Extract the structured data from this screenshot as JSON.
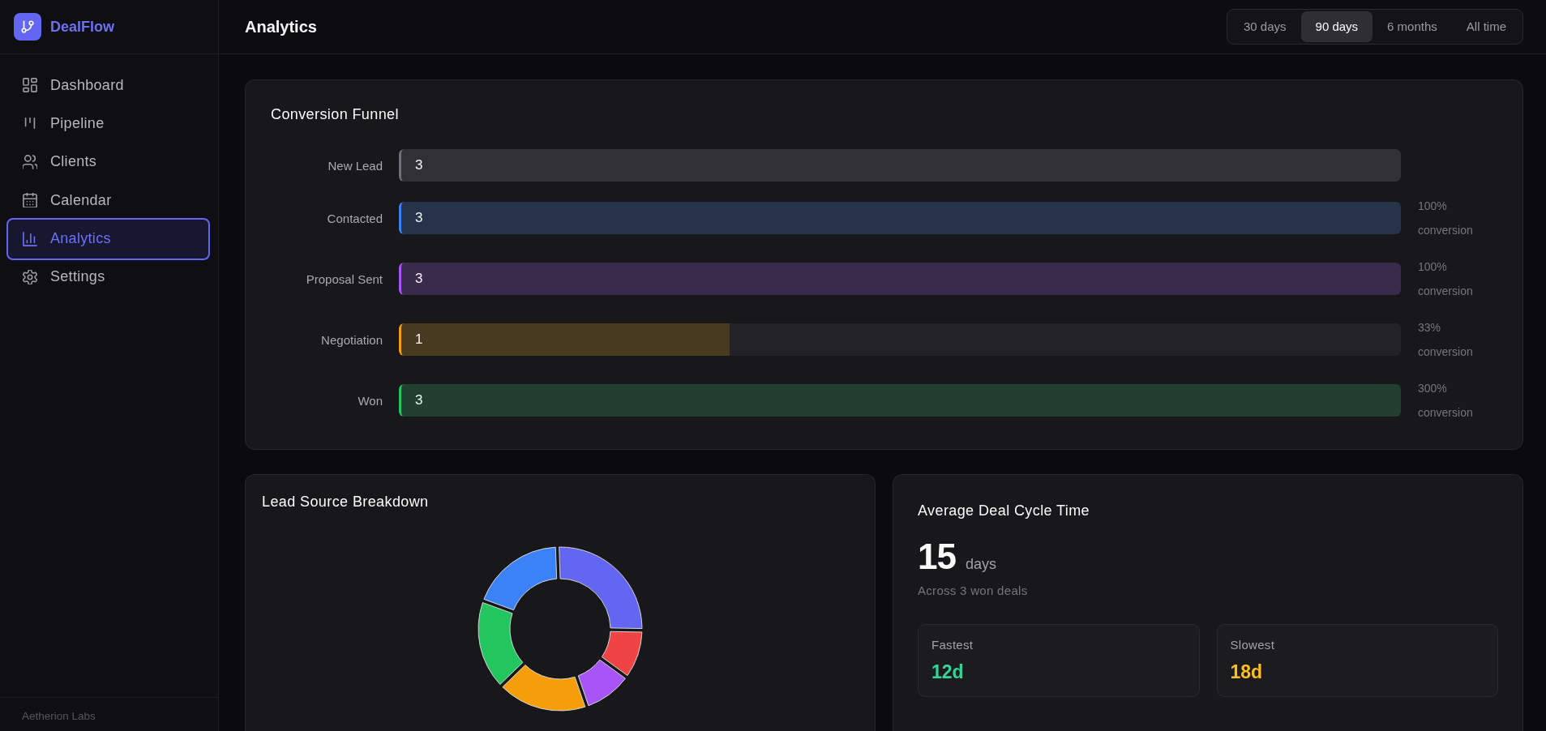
{
  "sidebar": {
    "brand": "DealFlow",
    "items": [
      {
        "label": "Dashboard",
        "selected": false
      },
      {
        "label": "Pipeline",
        "selected": false
      },
      {
        "label": "Clients",
        "selected": false
      },
      {
        "label": "Calendar",
        "selected": false
      },
      {
        "label": "Analytics",
        "selected": true
      },
      {
        "label": "Settings",
        "selected": false
      }
    ],
    "footer": "Aetherion Labs"
  },
  "header": {
    "title": "Analytics",
    "ranges": [
      {
        "label": "30 days",
        "selected": false
      },
      {
        "label": "90 days",
        "selected": true
      },
      {
        "label": "6 months",
        "selected": false
      },
      {
        "label": "All time",
        "selected": false
      }
    ]
  },
  "conversion_funnel": {
    "title": "Conversion Funnel",
    "stages": [
      {
        "label": "New Lead",
        "value": "3",
        "level": 1,
        "color": "#71717a"
      },
      {
        "label": "Contacted",
        "value": "3",
        "level": 1,
        "color": "#3b82f6",
        "conversion": "100% conversion"
      },
      {
        "label": "Proposal Sent",
        "value": "3",
        "level": 1,
        "color": "#a855f7",
        "conversion": "100% conversion"
      },
      {
        "label": "Negotiation",
        "value": "1",
        "level": 0.33,
        "color": "#f59e0b",
        "conversion": "33% conversion"
      },
      {
        "label": "Won",
        "value": "3",
        "level": 1,
        "color": "#22c55e",
        "conversion": "300% conversion"
      }
    ]
  },
  "lead_source_breakdown": {
    "title": "Lead Source Breakdown",
    "slices": [
      {
        "color": "#6366f1"
      },
      {
        "color": "#ef4444"
      },
      {
        "color": "#a855f7"
      },
      {
        "color": "#f59e0b"
      },
      {
        "color": "#22c55e"
      },
      {
        "color": "#3b82f6"
      }
    ]
  },
  "deal_cycle": {
    "title": "Average Deal Cycle Time",
    "value": "15",
    "unit": "days",
    "caption": "Across 3 won deals",
    "stats": [
      {
        "label": "Fastest",
        "value": "12d",
        "color": "#34d399"
      },
      {
        "label": "Slowest",
        "value": "18d",
        "color": "#fbbf24"
      }
    ]
  }
}
